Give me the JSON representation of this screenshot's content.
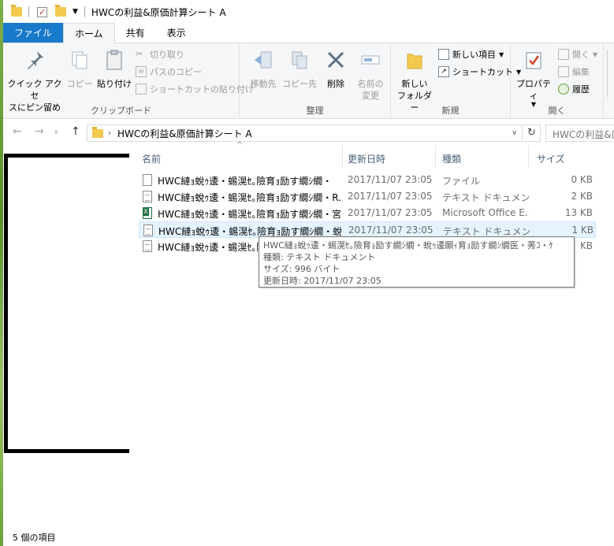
{
  "titlebar": {
    "title": "HWCの利益&原価計算シート A"
  },
  "tabs": [
    {
      "label": "ファイル"
    },
    {
      "label": "ホーム"
    },
    {
      "label": "共有"
    },
    {
      "label": "表示"
    }
  ],
  "ribbon": {
    "clipboard": {
      "label": "クリップボード",
      "pin_quick_access": "クイック アクセ\nスにピン留め",
      "copy": "コピー",
      "paste": "貼り付け",
      "cut": "切り取り",
      "copy_path": "パスのコピー",
      "paste_shortcut": "ショートカットの貼り付け"
    },
    "organize": {
      "label": "整理",
      "move_to": "移動先",
      "copy_to": "コピー先",
      "delete": "削除",
      "rename": "名前の\n変更"
    },
    "new": {
      "label": "新規",
      "new_folder": "新しい\nフォルダー",
      "new_item": "新しい項目",
      "shortcut": "ショートカット"
    },
    "open": {
      "label": "開く",
      "properties": "プロパティ",
      "open": "開く",
      "edit": "編集",
      "history": "履歴"
    }
  },
  "address": {
    "path": "HWCの利益&原価計算シート A",
    "search_placeholder": "HWCの利益&原"
  },
  "columns": [
    "名前",
    "更新日時",
    "種類",
    "サイズ"
  ],
  "files": [
    {
      "name": "HWC縺ｮ蛻ｩ逶・蜴滉ｾ｡險育ｮ励す繝ｼ繝・",
      "date": "2017/11/07 23:05",
      "type": "ファイル",
      "size": "0 KB",
      "icon": "blank-file-icon"
    },
    {
      "name": "HWC縺ｮ蛻ｩ逶・蜴滉ｾ｡險育ｮ励す繝ｼ繝・R...",
      "date": "2017/11/07 23:05",
      "type": "テキスト ドキュメント",
      "size": "2 KB",
      "icon": "text-file-icon"
    },
    {
      "name": "HWC縺ｮ蛻ｩ逶・蜴滉ｾ｡險育ｮ励す繝ｼ繝・宮...",
      "date": "2017/11/07 23:05",
      "type": "Microsoft Office E...",
      "size": "13 KB",
      "icon": "excel-file-icon"
    },
    {
      "name": "HWC縺ｮ蛻ｩ逶・蜴滉ｾ｡險育ｮ励す繝ｼ繝・蛻...",
      "date": "2017/11/07 23:05",
      "type": "テキスト ドキュメント",
      "size": "1 KB",
      "icon": "text-file-icon"
    },
    {
      "name": "HWC縺ｮ蛻ｩ逶・蜴滉ｾ｡險育ｮ励す繝ｼ繝・蛻遶",
      "date": "",
      "type": "",
      "size": "KB",
      "icon": "text-file-icon"
    }
  ],
  "tooltip": {
    "line1": "HWC縺ｮ蛻ｩ逶・蜴滉ｾ｡險育ｮ励す繝ｼ繝・蛻ｩ逶願ｨ育ｮ励す繝ｼ繝医・莠ｺ・ｹ",
    "line2": "種類: テキスト ドキュメント",
    "line3": "サイズ: 996 バイト",
    "line4": "更新日時: 2017/11/07 23:05"
  },
  "status": {
    "count": "5 個の項目"
  },
  "colors": {
    "file_tab": "#1979ca",
    "selected_row": "#e5f3ff",
    "header_text": "#4c607a"
  }
}
